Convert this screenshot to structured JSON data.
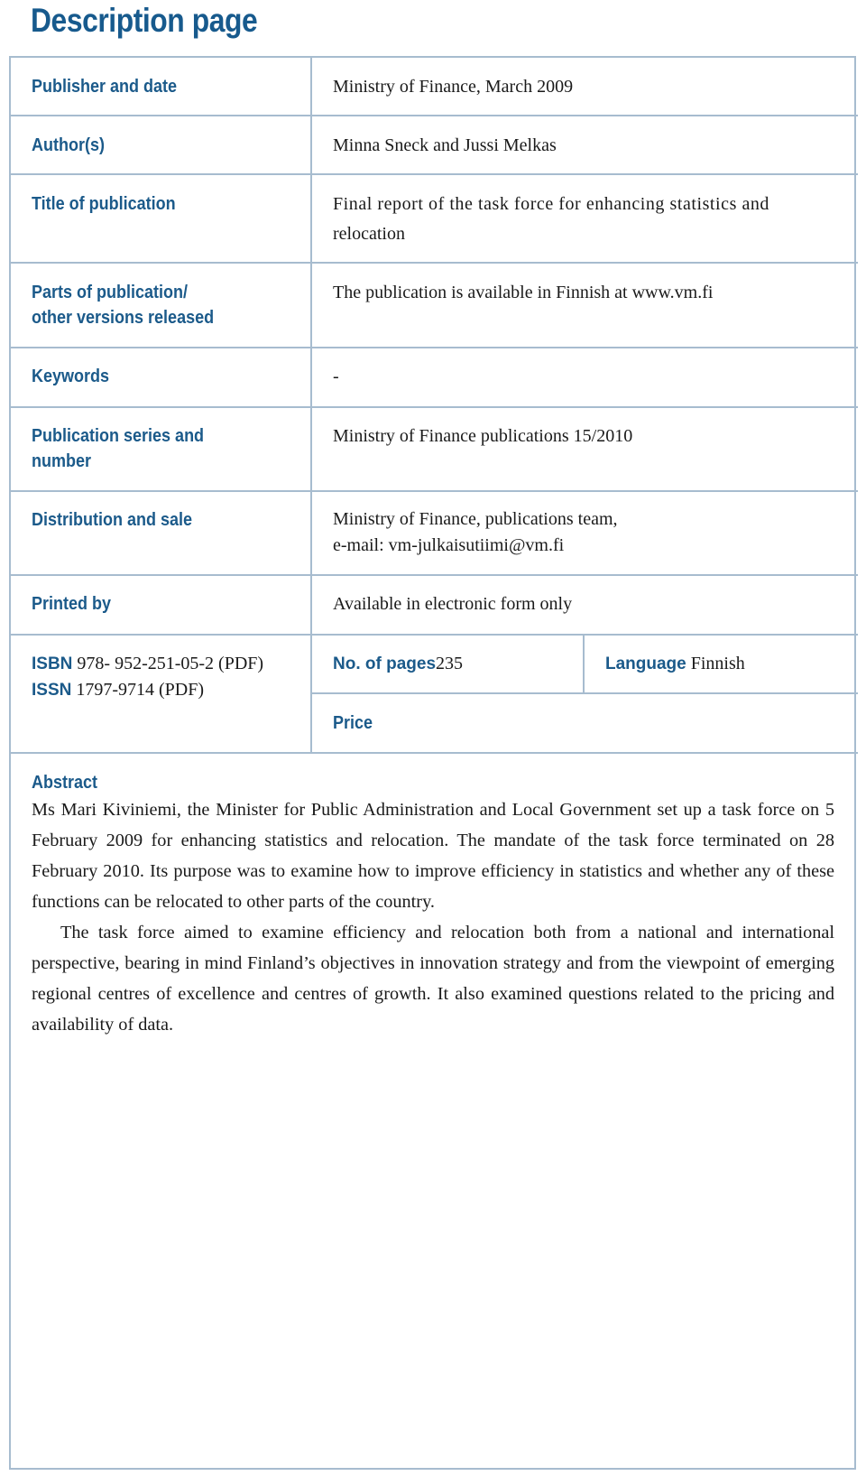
{
  "page_title": "Description page",
  "rows": [
    {
      "label": "Publisher and date",
      "value": "Ministry of Finance, March 2009"
    },
    {
      "label": "Author(s)",
      "value": "Minna Sneck and Jussi Melkas"
    },
    {
      "label": "Title of publication",
      "value_line1": "Final report of the task force for enhancing statistics and",
      "value_line2": "relocation"
    },
    {
      "label_line1": "Parts of publication/",
      "label_line2": "other versions released",
      "value": "The publication is available in Finnish at www.vm.fi"
    },
    {
      "label": "Keywords",
      "value": "-"
    },
    {
      "label_line1": "Publication series and",
      "label_line2": "number",
      "value": "Ministry of Finance publications 15/2010"
    },
    {
      "label": "Distribution and sale",
      "value_line1": "Ministry of Finance, publications team,",
      "value_line2": "e-mail: vm-julkaisutiimi@vm.fi"
    },
    {
      "label": "Printed by",
      "value": "Available in electronic form only"
    }
  ],
  "identifiers": {
    "isbn_label": "ISBN",
    "isbn_value": "978- 952-251-05-2  (PDF)",
    "issn_label": "ISSN",
    "issn_value": "1797-9714 (PDF)",
    "pages_label": "No. of pages",
    "pages_value": "235",
    "language_label": "Language",
    "language_value": "Finnish",
    "price_label": "Price"
  },
  "abstract": {
    "heading": "Abstract",
    "paragraphs": [
      "Ms Mari Kiviniemi, the Minister for Public Administration and Local Government set up a task force on 5 February 2009 for enhancing statistics and relocation. The mandate of the task force terminated on 28 February 2010. Its purpose was to examine how to improve efficiency in statistics and whether any of these functions can be relocated to other parts of the country.",
      "The task force aimed to examine efficiency and relocation both from a national and international perspective, bearing in mind Finland’s objectives in innovation strategy and from the viewpoint of emerging regional centres of excellence and centres of growth. It also examined questions related to the pricing and availability of data."
    ]
  }
}
